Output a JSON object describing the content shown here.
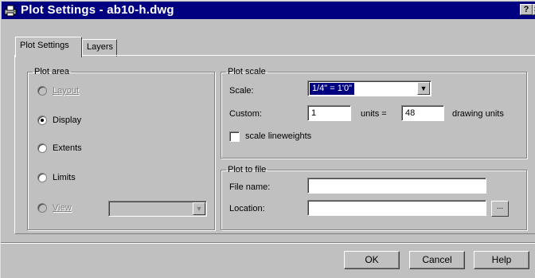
{
  "window": {
    "title": "Plot Settings - ab10-h.dwg",
    "help_button": "?",
    "close_button": "×"
  },
  "tabs": [
    {
      "label": "Plot Settings",
      "active": true
    },
    {
      "label": "Layers",
      "active": false
    }
  ],
  "plot_area": {
    "legend": "Plot area",
    "options": [
      {
        "label": "Layout",
        "enabled": false,
        "selected": false
      },
      {
        "label": "Display",
        "enabled": true,
        "selected": true
      },
      {
        "label": "Extents",
        "enabled": true,
        "selected": false
      },
      {
        "label": "Limits",
        "enabled": true,
        "selected": false
      },
      {
        "label": "View",
        "enabled": false,
        "selected": false
      }
    ],
    "view_dropdown_value": ""
  },
  "plot_scale": {
    "legend": "Plot scale",
    "scale_label": "Scale:",
    "scale_value": "1/4\" = 1'0\"",
    "custom_label": "Custom:",
    "custom_units_value": "1",
    "units_equals_label": "units =",
    "custom_drawing_value": "48",
    "drawing_units_label": "drawing units",
    "lineweights_label": "scale lineweights",
    "lineweights_checked": false
  },
  "plot_to_file": {
    "legend": "Plot to file",
    "file_name_label": "File name:",
    "file_name_value": "",
    "location_label": "Location:",
    "location_value": "",
    "browse_label": "..."
  },
  "buttons": {
    "ok": "OK",
    "cancel": "Cancel",
    "help": "Help"
  },
  "colors": {
    "titlebar": "#000080",
    "face": "#c0c0c0",
    "selection": "#000080"
  }
}
